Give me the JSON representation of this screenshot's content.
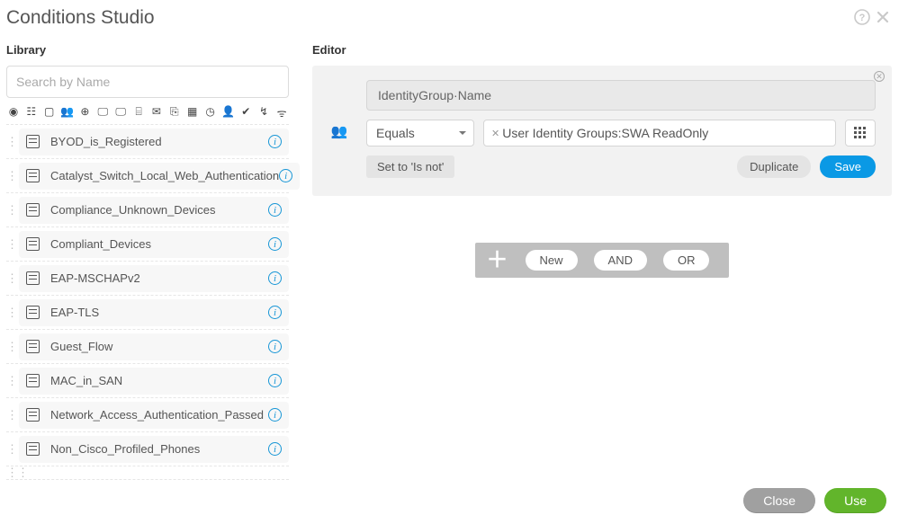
{
  "title": "Conditions Studio",
  "library_label": "Library",
  "editor_label": "Editor",
  "search": {
    "placeholder": "Search by Name"
  },
  "library_items": [
    {
      "name": "BYOD_is_Registered"
    },
    {
      "name": "Catalyst_Switch_Local_Web_Authentication"
    },
    {
      "name": "Compliance_Unknown_Devices"
    },
    {
      "name": "Compliant_Devices"
    },
    {
      "name": "EAP-MSCHAPv2"
    },
    {
      "name": "EAP-TLS"
    },
    {
      "name": "Guest_Flow"
    },
    {
      "name": "MAC_in_SAN"
    },
    {
      "name": "Network_Access_Authentication_Passed"
    },
    {
      "name": "Non_Cisco_Profiled_Phones"
    }
  ],
  "editor": {
    "attribute": "IdentityGroup·Name",
    "operator": "Equals",
    "value": "User Identity Groups:SWA ReadOnly",
    "set_to": "Set to 'Is not'",
    "duplicate": "Duplicate",
    "save": "Save"
  },
  "add_bar": {
    "new": "New",
    "and": "AND",
    "or": "OR"
  },
  "buttons": {
    "close": "Close",
    "use": "Use"
  }
}
